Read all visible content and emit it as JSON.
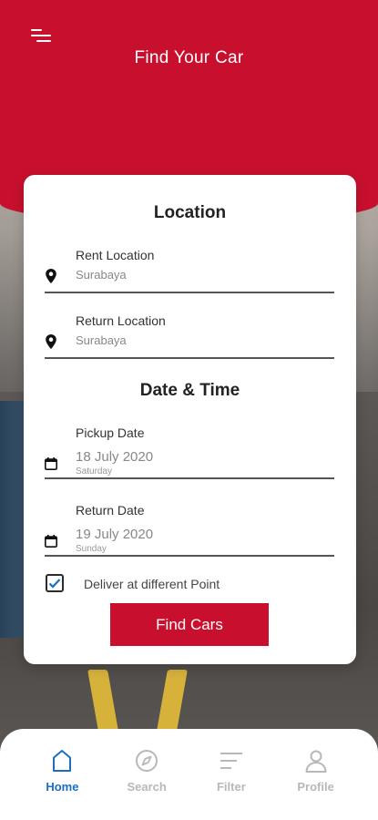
{
  "header": {
    "title": "Find Your Car"
  },
  "location": {
    "title": "Location",
    "rent_label": "Rent Location",
    "rent_value": "Surabaya",
    "return_label": "Return Location",
    "return_value": "Surabaya"
  },
  "datetime": {
    "title": "Date & Time",
    "pickup_label": "Pickup Date",
    "pickup_date": "18 July 2020",
    "pickup_day": "Saturday",
    "return_label": "Return Date",
    "return_date": "19 July 2020",
    "return_day": "Sunday"
  },
  "options": {
    "deliver_label": "Deliver at different Point",
    "deliver_checked": true
  },
  "cta": {
    "label": "Find Cars"
  },
  "nav": {
    "items": [
      {
        "label": "Home",
        "icon": "home-icon",
        "active": true
      },
      {
        "label": "Search",
        "icon": "compass-icon",
        "active": false
      },
      {
        "label": "Filter",
        "icon": "filter-icon",
        "active": false
      },
      {
        "label": "Profile",
        "icon": "profile-icon",
        "active": false
      }
    ]
  },
  "colors": {
    "brand": "#c8102e",
    "active_nav": "#1a6fc4",
    "inactive_nav": "#b8b8b8"
  }
}
